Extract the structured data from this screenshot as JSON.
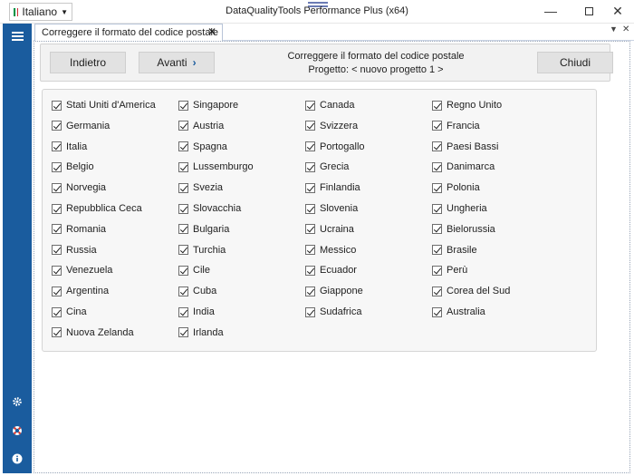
{
  "window": {
    "title": "DataQualityTools Performance Plus (x64)",
    "language": "Italiano",
    "minimize_icon": "minimize-icon",
    "maximize_icon": "maximize-icon",
    "close_icon": "close-icon"
  },
  "sidebar": {
    "menu_icon": "menu-icon",
    "settings_icon": "gear-icon",
    "help_icon": "lifebuoy-icon",
    "info_icon": "info-icon",
    "color": "#1a5c9e"
  },
  "tab": {
    "label": "Correggere il formato del codice postale",
    "close": "✕"
  },
  "toolbar": {
    "back_label": "Indietro",
    "next_label": "Avanti",
    "close_label": "Chiudi",
    "heading_title": "Correggere il formato del codice postale",
    "heading_project": "Progetto: < nuovo progetto 1 >"
  },
  "countries": [
    [
      "Stati Uniti d'America",
      "Singapore",
      "Canada",
      "Regno Unito"
    ],
    [
      "Germania",
      "Austria",
      "Svizzera",
      "Francia"
    ],
    [
      "Italia",
      "Spagna",
      "Portogallo",
      "Paesi Bassi"
    ],
    [
      "Belgio",
      "Lussemburgo",
      "Grecia",
      "Danimarca"
    ],
    [
      "Norvegia",
      "Svezia",
      "Finlandia",
      "Polonia"
    ],
    [
      "Repubblica Ceca",
      "Slovacchia",
      "Slovenia",
      "Ungheria"
    ],
    [
      "Romania",
      "Bulgaria",
      "Ucraina",
      "Bielorussia"
    ],
    [
      "Russia",
      "Turchia",
      "Messico",
      "Brasile"
    ],
    [
      "Venezuela",
      "Cile",
      "Ecuador",
      "Perù"
    ],
    [
      "Argentina",
      "Cuba",
      "Giappone",
      "Corea del Sud"
    ],
    [
      "Cina",
      "India",
      "Sudafrica",
      "Australia"
    ],
    [
      "Nuova Zelanda",
      "Irlanda"
    ]
  ],
  "countries_checked": true
}
